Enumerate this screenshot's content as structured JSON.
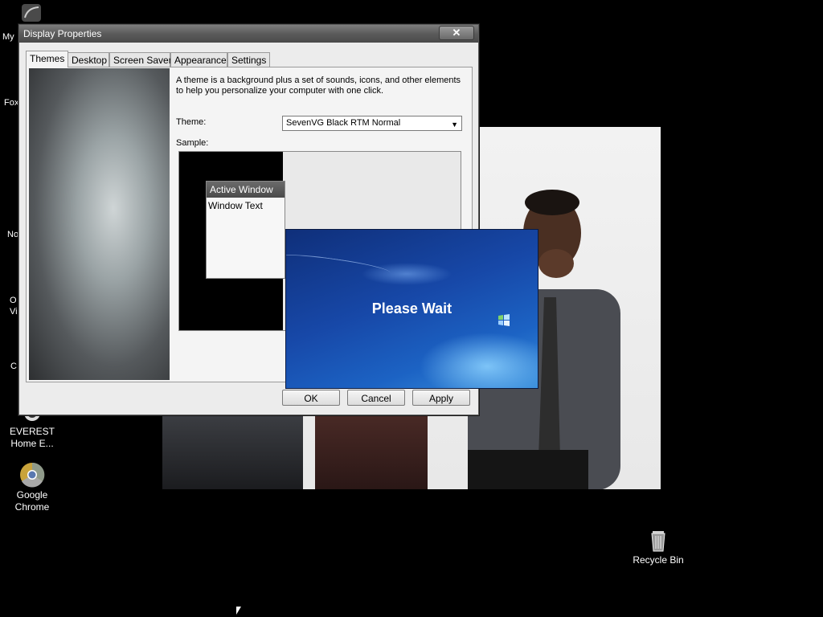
{
  "desktop": {
    "icons": [
      {
        "name": "EVEREST\nHome E...",
        "line1": "EVEREST",
        "line2": "Home E..."
      },
      {
        "name": "Google Chrome",
        "line1": "Google",
        "line2": "Chrome"
      },
      {
        "name": "Recycle Bin",
        "line1": "Recycle Bin",
        "line2": ""
      }
    ],
    "edge_labels": [
      "My",
      "Fox",
      "No",
      "O",
      "Vi",
      "C"
    ]
  },
  "window": {
    "title": "Display Properties",
    "close_glyph": "✕",
    "tabs": [
      "Themes",
      "Desktop",
      "Screen Saver",
      "Appearance",
      "Settings"
    ],
    "active_tab": "Themes",
    "description": "A theme is a background plus a set of sounds, icons, and other elements to help you personalize your computer with one click.",
    "theme_label": "Theme:",
    "theme_value": "SevenVG Black RTM Normal",
    "sample_label": "Sample:",
    "sample_window_title": "Active Window",
    "sample_window_text": "Window Text",
    "buttons": {
      "ok": "OK",
      "cancel": "Cancel",
      "apply": "Apply"
    }
  },
  "splash": {
    "message": "Please Wait"
  },
  "colors": {
    "desktop_bg": "#000000",
    "splash_blue": "#1748a8",
    "titlebar": "#5b5b5b"
  }
}
